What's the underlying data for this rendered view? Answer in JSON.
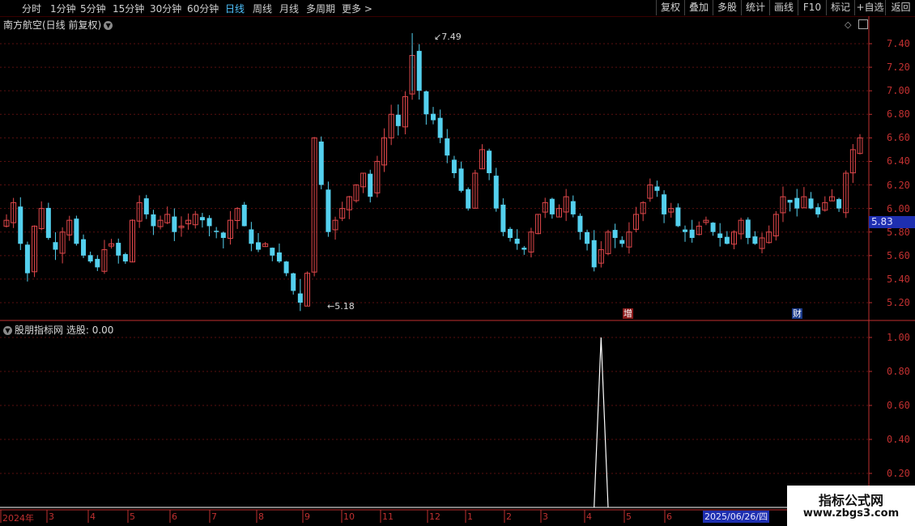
{
  "toolbar": {
    "periods": [
      "分时",
      "1分钟",
      "5分钟",
      "15分钟",
      "30分钟",
      "60分钟",
      "日线",
      "周线",
      "月线",
      "多周期",
      "更多 >"
    ],
    "active_period": "日线",
    "tools": [
      "复权",
      "叠加",
      "多股",
      "统计",
      "画线",
      "F10",
      "标记",
      "+自选",
      "返回"
    ]
  },
  "main_chart": {
    "title": "南方航空(日线 前复权)",
    "price_ticks": [
      "7.40",
      "7.20",
      "7.00",
      "6.80",
      "6.60",
      "6.40",
      "6.20",
      "6.00",
      "5.80",
      "5.60",
      "5.40",
      "5.20"
    ],
    "current_price": "5.83",
    "high_label": "7.49",
    "low_label": "5.18",
    "badges": [
      "增",
      "财"
    ]
  },
  "indicator": {
    "title": "股朋指标网",
    "value_label": "选股: 0.00",
    "ticks": [
      "1.00",
      "0.80",
      "0.60",
      "0.40",
      "0.20"
    ]
  },
  "time_axis": {
    "labels": [
      "2024年",
      "3",
      "4",
      "5",
      "6",
      "7",
      "8",
      "9",
      "10",
      "11",
      "12",
      "1",
      "2",
      "3",
      "4",
      "5",
      "6"
    ],
    "cursor_date": "2025/06/26/四"
  },
  "watermark": {
    "line1": "指标公式网",
    "line2": "www.zbgs3.com"
  },
  "colors": {
    "up": "#e0474a",
    "down": "#54d0ee",
    "axis": "#c03030",
    "accent": "#4fc3ff",
    "tag_bg": "#1e2fb0"
  },
  "chart_data": [
    {
      "type": "candlestick",
      "title": "南方航空(日线 前复权)",
      "ylim": [
        5.1,
        7.55
      ],
      "x_range": [
        "2024年",
        "2025/06/26/四"
      ],
      "high": 7.49,
      "low": 5.18,
      "close": [
        5.9,
        6.05,
        5.7,
        5.45,
        5.85,
        6.0,
        5.75,
        5.65,
        5.8,
        5.9,
        5.7,
        5.6,
        5.55,
        5.5,
        5.65,
        5.7,
        5.6,
        5.55,
        5.9,
        6.05,
        5.95,
        5.85,
        5.9,
        5.95,
        5.8,
        5.85,
        5.9,
        5.95,
        5.9,
        5.85,
        5.8,
        5.75,
        5.9,
        6.0,
        5.85,
        5.7,
        5.65,
        5.7,
        5.6,
        5.55,
        5.45,
        5.3,
        5.2,
        5.45,
        6.6,
        6.2,
        5.8,
        5.9,
        6.0,
        6.1,
        6.2,
        6.3,
        6.1,
        6.4,
        6.6,
        6.8,
        6.7,
        6.95,
        7.3,
        7.0,
        6.8,
        6.75,
        6.6,
        6.45,
        6.3,
        6.15,
        6.0,
        6.3,
        6.5,
        6.3,
        6.0,
        5.8,
        5.75,
        5.7,
        5.65,
        5.8,
        5.95,
        6.05,
        5.95,
        6.0,
        6.1,
        5.95,
        5.8,
        5.7,
        5.5,
        5.65,
        5.8,
        5.75,
        5.7,
        5.8,
        5.95,
        6.05,
        6.2,
        6.15,
        5.95,
        6.0,
        5.85,
        5.8,
        5.75,
        5.85,
        5.9,
        5.8,
        5.75,
        5.7,
        5.8,
        5.9,
        5.75,
        5.7,
        5.75,
        5.8,
        5.95,
        6.1,
        6.05,
        6.0,
        6.1,
        6.0,
        5.95,
        6.05,
        6.1,
        6.0,
        6.3,
        6.5,
        6.6
      ]
    },
    {
      "type": "line",
      "title": "股朋指标网",
      "ylim": [
        0,
        1.1
      ],
      "x_index": [
        84,
        85,
        86
      ],
      "values": [
        0,
        1.0,
        0
      ]
    }
  ]
}
